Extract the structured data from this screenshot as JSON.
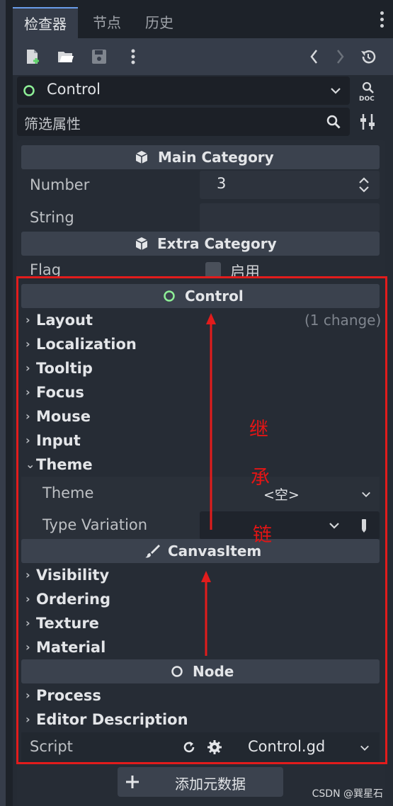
{
  "tabs": [
    {
      "label": "检查器",
      "active": true
    },
    {
      "label": "节点",
      "active": false
    },
    {
      "label": "历史",
      "active": false
    }
  ],
  "toolbar": {
    "icons": [
      "new-resource-icon",
      "open-folder-icon",
      "save-icon",
      "more-icon",
      "back-icon",
      "forward-icon",
      "history-icon"
    ]
  },
  "object_selector": {
    "value": "Control"
  },
  "doc_button": {
    "label": "DOC"
  },
  "filter": {
    "placeholder": "筛选属性"
  },
  "main_category": {
    "title": "Main Category",
    "number_label": "Number",
    "number_value": "3",
    "string_label": "String",
    "string_value": ""
  },
  "extra_category": {
    "title": "Extra Category",
    "flag_label": "Flag",
    "flag_checkbox_label": "启用"
  },
  "control_category": {
    "title": "Control",
    "sections": [
      "Layout",
      "Localization",
      "Tooltip",
      "Focus",
      "Mouse",
      "Input",
      "Theme"
    ],
    "layout_change": "(1 change)",
    "theme_label": "Theme",
    "theme_value": "<空>",
    "type_variation_label": "Type Variation"
  },
  "canvasitem_category": {
    "title": "CanvasItem",
    "sections": [
      "Visibility",
      "Ordering",
      "Texture",
      "Material"
    ]
  },
  "node_category": {
    "title": "Node",
    "sections": [
      "Process",
      "Editor Description"
    ],
    "script_label": "Script",
    "script_value": "Control.gd"
  },
  "add_metadata": {
    "label": "添加元数据"
  },
  "annotation": {
    "chars": [
      "继",
      "承",
      "链"
    ]
  },
  "watermark": "CSDN @巽星石",
  "colors": {
    "accent": "#699ce8",
    "control_green": "#8eef97",
    "annotation_red": "#e21c1c"
  }
}
